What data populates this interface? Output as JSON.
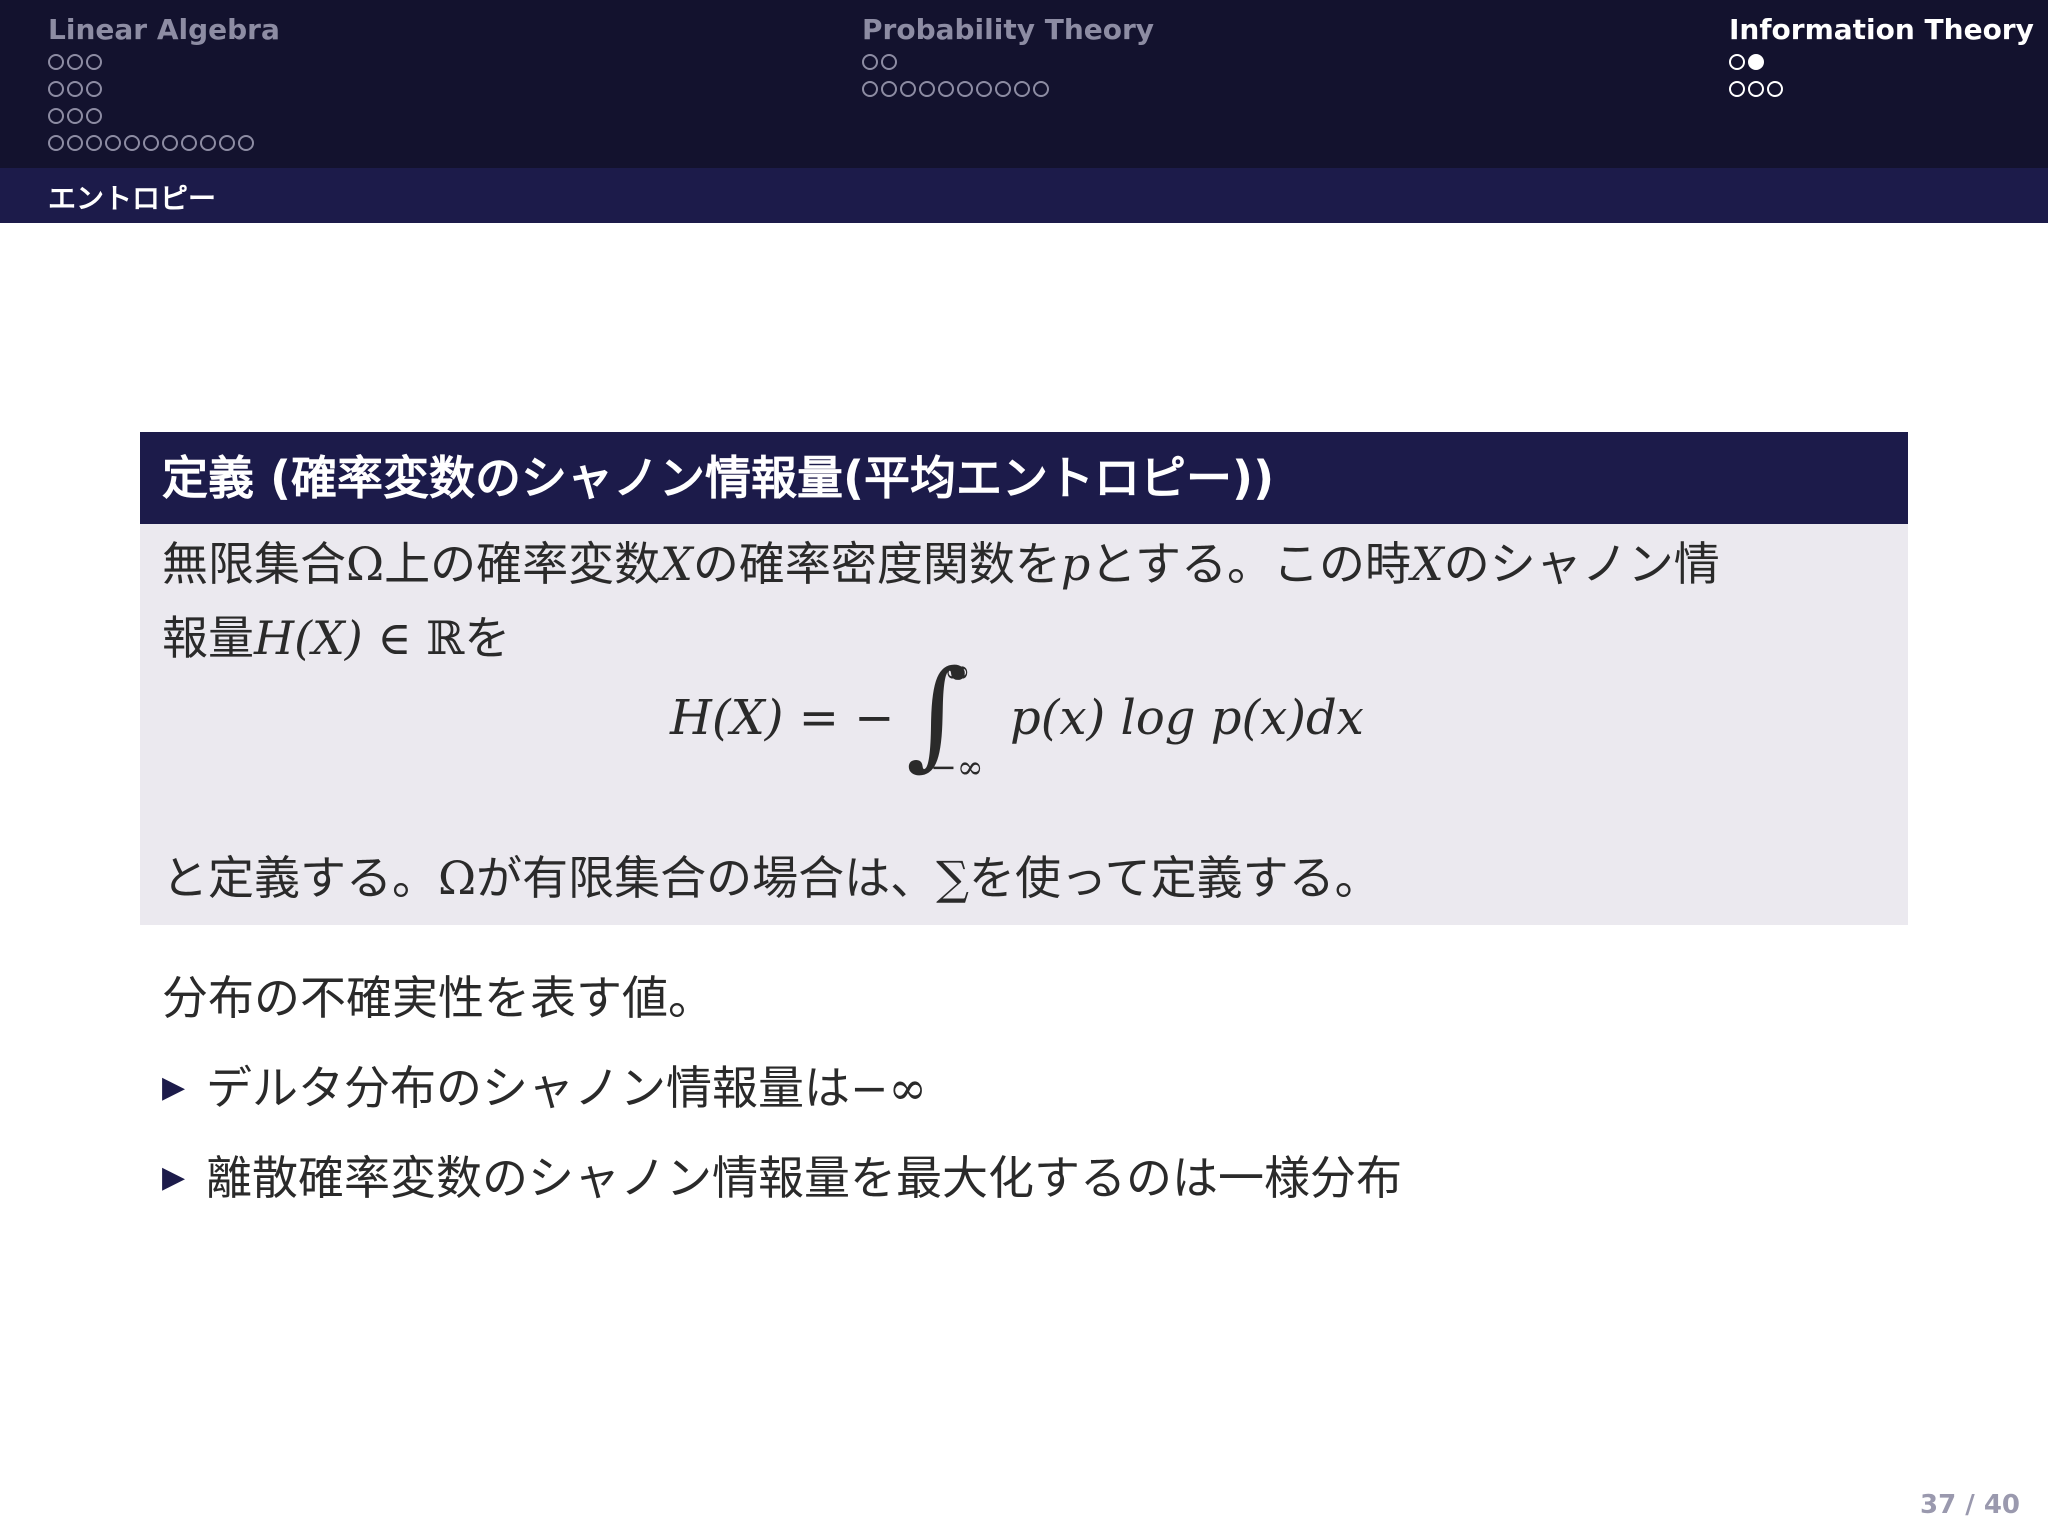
{
  "nav": {
    "sections": [
      {
        "title": "Linear Algebra",
        "active": false,
        "rows": [
          3,
          3,
          3,
          11
        ],
        "filled": []
      },
      {
        "title": "Probability Theory",
        "active": false,
        "rows": [
          2,
          10
        ],
        "filled": []
      },
      {
        "title": "Information Theory",
        "active": true,
        "rows": [
          2,
          3
        ],
        "filled": [
          [
            0,
            1
          ]
        ]
      }
    ],
    "subsection": "エントロピー"
  },
  "definition": {
    "title": "定義 (確率変数のシャノン情報量(平均エントロピー))",
    "line1_a": "無限集合",
    "omega": "Ω",
    "line1_b": "上の確率変数",
    "X": "X",
    "line1_c": "の確率密度関数を",
    "p": "p",
    "line1_d": "とする。この時",
    "line1_e": "のシャノン情",
    "line2_a": "報量",
    "HX": "H(X)",
    "in_R": " ∈ ℝ",
    "line2_b": "を",
    "formula_lhs": "H(X) = −",
    "integral_symbol": "∫",
    "upper_limit": "∞",
    "lower_limit": "−∞",
    "formula_integrand": "p(x) log p(x)dx",
    "line3_a": "と定義する。",
    "line3_b": "が有限集合の場合は、",
    "sum_symbol": "∑",
    "line3_c": "を使って定義する。"
  },
  "main_text": "分布の不確実性を表す値。",
  "bullets": [
    {
      "marker": "▶",
      "text": "デルタ分布のシャノン情報量は",
      "math": "−∞"
    },
    {
      "marker": "▶",
      "text": "離散確率変数のシャノン情報量を最大化するのは一様分布",
      "math": ""
    }
  ],
  "page_number": "37 / 40",
  "colors": {
    "nav_bg": "#13122e",
    "subnav_bg": "#1c1b4a",
    "block_body_bg": "#ebe9ef",
    "muted": "#8d8ca3"
  }
}
